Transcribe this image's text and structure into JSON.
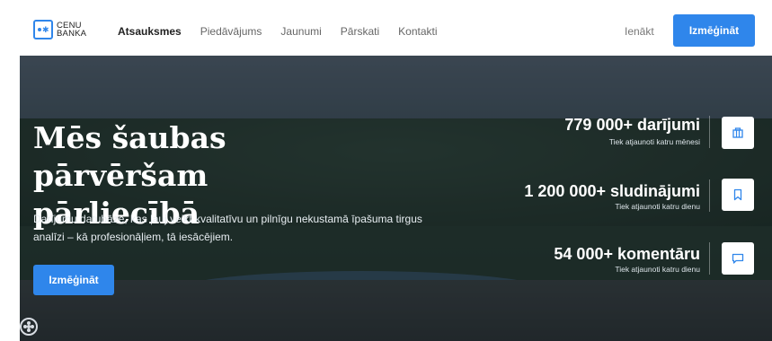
{
  "brand": {
    "logo_line1": "CENU",
    "logo_line2": "BANKA"
  },
  "nav": {
    "items": [
      {
        "label": "Atsauksmes"
      },
      {
        "label": "Piedāvājums"
      },
      {
        "label": "Jaunumi"
      },
      {
        "label": "Pārskati"
      },
      {
        "label": "Kontakti"
      }
    ],
    "login_label": "Ienākt",
    "cta_label": "Izmēģināt"
  },
  "hero": {
    "title_line1": "Mēs šaubas pārvēršam",
    "title_line2": "pārliecībā",
    "subtitle_line1": "Darījumu datubāze, kas ļauj veikt kvalitatīvu un pilnīgu nekustamā īpašuma tirgus",
    "subtitle_line2": "analīzi – kā profesionāļiem, tā iesācējiem.",
    "cta_label": "Izmēģināt"
  },
  "stats": [
    {
      "value": "779 000+ darījumi",
      "caption": "Tiek atjaunoti katru mēnesi",
      "icon": "building-icon"
    },
    {
      "value": "1 200 000+ sludinājumi",
      "caption": "Tiek atjaunoti katru dienu",
      "icon": "bookmark-icon"
    },
    {
      "value": "54 000+ komentāru",
      "caption": "Tiek atjaunoti katru dienu",
      "icon": "comment-icon"
    }
  ],
  "colors": {
    "accent": "#2f86eb",
    "hero_text": "#ffffff"
  }
}
